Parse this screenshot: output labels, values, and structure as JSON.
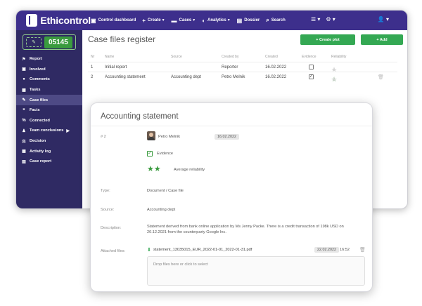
{
  "app": {
    "brand": "Ethicontrol",
    "nav": [
      {
        "icon": "dashboard-icon",
        "glyph": "▣",
        "label": "Control dashboard",
        "caret": ""
      },
      {
        "icon": "plus-icon",
        "glyph": "+",
        "label": "Create",
        "caret": "▼"
      },
      {
        "icon": "folder-icon",
        "glyph": "▬",
        "label": "Cases",
        "caret": "▼"
      },
      {
        "icon": "chart-icon",
        "glyph": "◐",
        "label": "Analytics",
        "caret": "▼"
      },
      {
        "icon": "dossier-icon",
        "glyph": "▤",
        "label": "Dossier",
        "caret": ""
      },
      {
        "icon": "search-icon",
        "glyph": "⌕",
        "label": "Search",
        "caret": ""
      }
    ],
    "top_right": {
      "menu_glyph": "☰ ▾",
      "settings_glyph": "⚙ ▾",
      "user_glyph": "👤 ▾"
    }
  },
  "sidebar": {
    "case_number": "05145",
    "items": [
      {
        "icon": "flag-icon",
        "glyph": "⚑",
        "label": "Report",
        "active": false,
        "arrow": ""
      },
      {
        "icon": "involved-icon",
        "glyph": "▣",
        "label": "Involved",
        "active": false,
        "arrow": ""
      },
      {
        "icon": "comments-icon",
        "glyph": "●",
        "label": "Comments",
        "active": false,
        "arrow": ""
      },
      {
        "icon": "tasks-icon",
        "glyph": "▦",
        "label": "Tasks",
        "active": false,
        "arrow": ""
      },
      {
        "icon": "paperclip-icon",
        "glyph": "✎",
        "label": "Case files",
        "active": true,
        "arrow": ""
      },
      {
        "icon": "quote-icon",
        "glyph": "❞",
        "label": "Facts",
        "active": false,
        "arrow": ""
      },
      {
        "icon": "connected-icon",
        "glyph": "%",
        "label": "Connected",
        "active": false,
        "arrow": ""
      },
      {
        "icon": "team-icon",
        "glyph": "♟",
        "label": "Team conclusions",
        "active": false,
        "arrow": "▶"
      },
      {
        "icon": "gavel-icon",
        "glyph": "⚖",
        "label": "Decision",
        "active": false,
        "arrow": ""
      },
      {
        "icon": "calendar-icon",
        "glyph": "▦",
        "label": "Activity log",
        "active": false,
        "arrow": ""
      },
      {
        "icon": "case-report-icon",
        "glyph": "▤",
        "label": "Case report",
        "active": false,
        "arrow": ""
      }
    ]
  },
  "register": {
    "title": "Case files register",
    "create_plot_label": "+ Create plot",
    "add_label": "+ Add",
    "columns": [
      "Nr",
      "Name",
      "Source",
      "Created by",
      "Created",
      "Evidence",
      "Reliability"
    ],
    "rows": [
      {
        "nr": "1",
        "name": "Initial report",
        "source": "",
        "created_by": "Reporter",
        "created": "16.02.2022",
        "evidence": false,
        "reliability": 0
      },
      {
        "nr": "2",
        "name": "Accounting statement",
        "source": "Accounting dept",
        "created_by": "Petro Melnik",
        "created": "16.02.2022",
        "evidence": true,
        "reliability": 2
      }
    ]
  },
  "detail": {
    "title": "Accounting statement",
    "number": "# 2",
    "author": "Petro Melnik",
    "author_date": "16.02.2022",
    "evidence_label": "Evidence",
    "reliability_stars": 2,
    "reliability_label": "Average reliability",
    "type_label": "Type:",
    "type_value": "Document / Case file",
    "source_label": "Source:",
    "source_value": "Accounting dept",
    "description_label": "Description:",
    "description_line1": "Statement derived from bank online application by Ms Jenny Packe. There is a credit transaction of 198k USD on",
    "description_line2": "20.12.2021 from the counterparty Google Inc.",
    "attached_label": "Attached files:",
    "file_name": "statement_13035015_EUR_2022-01-01_2022-01-31.pdf",
    "file_date": "22.02.2022",
    "file_time": "16:52",
    "dropzone_text": "Drop files here or click to select"
  },
  "colors": {
    "header": "#3d2f8c",
    "sidebar": "#2f2a63",
    "accent": "#34a853"
  }
}
